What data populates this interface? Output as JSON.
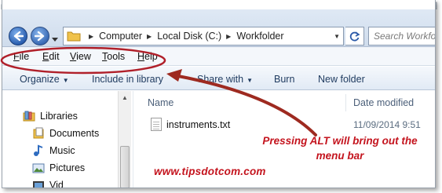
{
  "nav": {
    "back_icon": "back-arrow-icon",
    "forward_icon": "forward-arrow-icon"
  },
  "address": {
    "crumbs": [
      "Computer",
      "Local Disk (C:)",
      "Workfolder"
    ],
    "refresh_icon": "refresh-icon"
  },
  "search": {
    "placeholder": "Search Workfo"
  },
  "menubar": {
    "items": [
      {
        "first": "F",
        "rest": "ile"
      },
      {
        "first": "E",
        "rest": "dit"
      },
      {
        "first": "V",
        "rest": "iew"
      },
      {
        "first": "T",
        "rest": "ools"
      },
      {
        "first": "H",
        "rest": "elp"
      }
    ]
  },
  "toolbar": {
    "organize": "Organize",
    "include": "Include in library",
    "share": "Share with",
    "burn": "Burn",
    "new_folder": "New folder"
  },
  "sidebar": {
    "items": [
      {
        "label": "Libraries",
        "icon": "libraries-icon"
      },
      {
        "label": "Documents",
        "icon": "documents-icon"
      },
      {
        "label": "Music",
        "icon": "music-icon"
      },
      {
        "label": "Pictures",
        "icon": "pictures-icon"
      },
      {
        "label": "Vid",
        "icon": "videos-icon"
      }
    ]
  },
  "filelist": {
    "columns": [
      "Name",
      "Date modified"
    ],
    "rows": [
      {
        "name": "instruments.txt",
        "date": "11/09/2014 9:51"
      }
    ]
  },
  "annotation": {
    "callout_line1": "Pressing ALT will bring out the",
    "callout_line2": "menu bar",
    "watermark": "www.tipsdotcom.com",
    "color": "#c4141e"
  }
}
